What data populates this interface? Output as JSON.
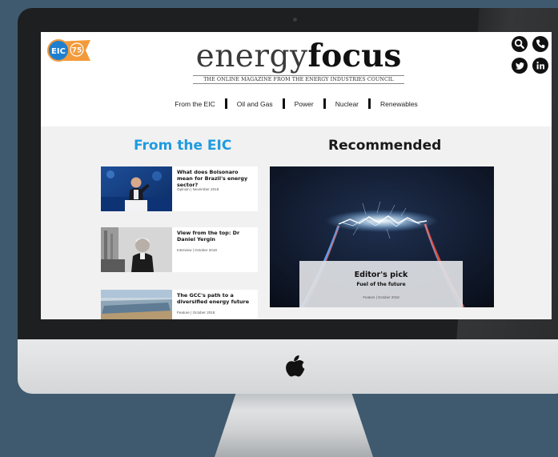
{
  "brand": {
    "logo_light": "energy",
    "logo_bold": "focus",
    "tagline": "THE ONLINE MAGAZINE FROM THE ENERGY INDUSTRIES COUNCIL",
    "eic_badge_text": "EIC",
    "eic_flag_text": "75",
    "accent_color": "#1e9be0",
    "flag_color": "#f39a3a"
  },
  "header_icons": [
    "search-icon",
    "phone-icon",
    "twitter-icon",
    "linkedin-icon"
  ],
  "nav": {
    "items": [
      "From the EIC",
      "Oil and Gas",
      "Power",
      "Nuclear",
      "Renewables"
    ]
  },
  "sections": {
    "left_title": "From the EIC",
    "right_title": "Recommended"
  },
  "articles": [
    {
      "title": "What does Bolsonaro mean for Brazil's energy sector?",
      "meta": "Opinion | November 2018"
    },
    {
      "title": "View from the top: Dr Daniel Yergin",
      "meta": "Interview | October 2018"
    },
    {
      "title": "The GCC's path to a diversified energy future",
      "meta": "Feature | October 2018"
    }
  ],
  "feature": {
    "label": "Editor's pick",
    "title": "Fuel of the future",
    "meta": "Feature | October 2018"
  }
}
